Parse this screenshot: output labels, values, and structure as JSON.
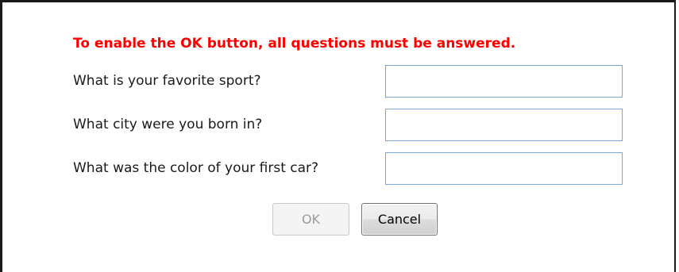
{
  "dialog": {
    "warning_text": "To enable the OK button, all questions must be answered.",
    "warning_color": "#ff0000",
    "questions": [
      {
        "label": "What is your favorite sport?",
        "value": "",
        "placeholder": ""
      },
      {
        "label": "What city were you born in?",
        "value": "",
        "placeholder": ""
      },
      {
        "label": "What was the color of your first car?",
        "value": "",
        "placeholder": ""
      }
    ],
    "buttons": {
      "ok_label": "OK",
      "ok_enabled": false,
      "cancel_label": "Cancel"
    }
  }
}
